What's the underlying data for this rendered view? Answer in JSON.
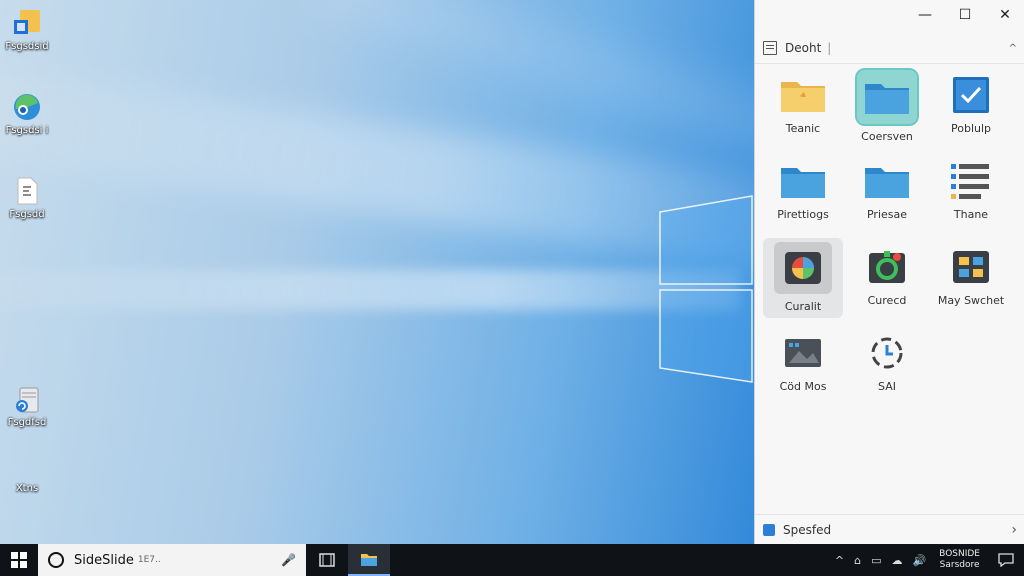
{
  "desktop": {
    "icons": [
      {
        "label": "Fsgsdsid",
        "icon": "folder-app-icon"
      },
      {
        "label": "Fsgsdsi i",
        "icon": "edge-browser-icon"
      },
      {
        "label": "Fsgsdd",
        "icon": "document-icon"
      },
      {
        "label": "Fsgdfsd",
        "icon": "recycle-bin-icon"
      },
      {
        "label": "Xtns",
        "icon": "shortcut-icon"
      }
    ]
  },
  "panel": {
    "header_title": "Deoht",
    "window_controls": {
      "minimize": "—",
      "maximize": "☐",
      "close": "✕"
    },
    "tiles": [
      {
        "label": "Teanic",
        "icon": "folder-yellow-icon"
      },
      {
        "label": "Coersven",
        "icon": "folder-blue-icon"
      },
      {
        "label": "Poblulp",
        "icon": "checkbox-icon"
      },
      {
        "label": "Pirettiogs",
        "icon": "folder-blue-icon"
      },
      {
        "label": "Priesae",
        "icon": "folder-blue-icon"
      },
      {
        "label": "Thane",
        "icon": "list-icon"
      },
      {
        "label": "Curalit",
        "icon": "palette-app-icon"
      },
      {
        "label": "Curecd",
        "icon": "green-app-icon"
      },
      {
        "label": "May Swchet",
        "icon": "grid-app-icon"
      },
      {
        "label": "Cöd Mos",
        "icon": "media-app-icon"
      },
      {
        "label": "SAI",
        "icon": "sync-icon"
      }
    ],
    "footer_title": "Spesfed"
  },
  "taskbar": {
    "search_text": "SideSlide",
    "search_sub": "1E7..",
    "clock_line1": "BOSNIDE",
    "clock_line2": "Sarsdore",
    "tray": [
      "^",
      "⌂",
      "▭",
      "☁",
      "🔊"
    ]
  },
  "colors": {
    "accent": "#0078d7",
    "taskbar": "#0f1217",
    "panel_bg": "#f7f7f7",
    "selected_tile": "#8fd6d2"
  }
}
